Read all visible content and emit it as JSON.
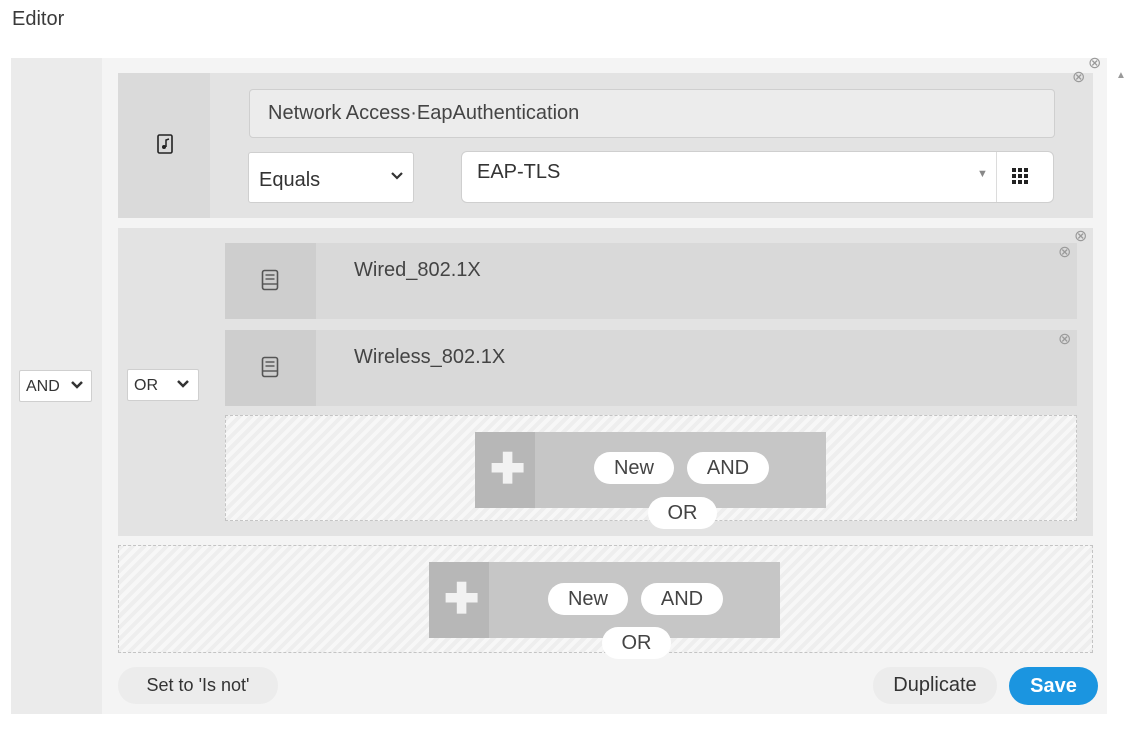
{
  "title": "Editor",
  "outer_operator": {
    "value": "AND"
  },
  "condition1": {
    "attribute": "Network Access·EapAuthentication",
    "operator": "Equals",
    "value": "EAP-TLS"
  },
  "group": {
    "operator": "OR",
    "items": [
      {
        "label": "Wired_802.1X"
      },
      {
        "label": "Wireless_802.1X"
      }
    ],
    "add": {
      "new": "New",
      "and": "AND",
      "or": "OR"
    }
  },
  "outer_add": {
    "new": "New",
    "and": "AND",
    "or": "OR"
  },
  "footer": {
    "set_isnot": "Set to 'Is not'",
    "duplicate": "Duplicate",
    "save": "Save"
  },
  "icons": {
    "attribute_dictionary": "dictionary-icon",
    "library_condition": "library-condition-icon",
    "remove": "close-circle-icon",
    "dropdown": "chevron-down-icon",
    "value_picker": "grid-icon",
    "add": "plus-icon"
  },
  "colors": {
    "save_button": "#1b95e0"
  }
}
